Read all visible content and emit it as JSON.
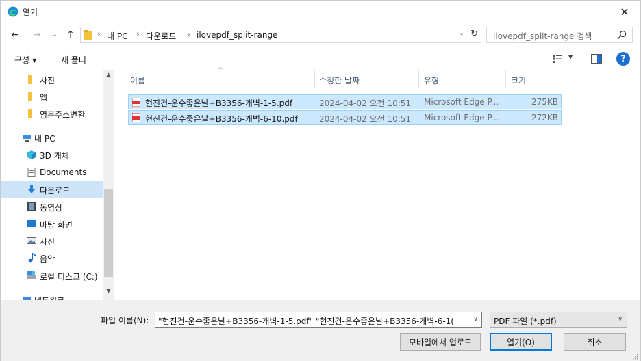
{
  "window": {
    "title": "열기",
    "close_glyph": "✕"
  },
  "nav": {
    "back_glyph": "←",
    "forward_glyph": "→",
    "recent_glyph": "⌄",
    "up_glyph": "↑",
    "breadcrumbs": [
      "내 PC",
      "다운로드",
      "ilovepdf_split-range"
    ],
    "separator": "›",
    "dropdown_glyph": "⌄",
    "refresh_glyph": "↻",
    "search_placeholder": "ilovepdf_split-range 검색"
  },
  "commands": {
    "organize": "구성",
    "organize_caret": "▼",
    "new_folder": "새 폴더",
    "view_caret": "▼",
    "help": "?"
  },
  "sidebar": {
    "items": [
      {
        "label": "사진",
        "icon": "folder-icon"
      },
      {
        "label": "앱",
        "icon": "folder-icon"
      },
      {
        "label": "영문주소변환",
        "icon": "folder-icon"
      },
      {
        "label": "내 PC",
        "icon": "pc-icon"
      },
      {
        "label": "3D 개체",
        "icon": "3d-objects-icon"
      },
      {
        "label": "Documents",
        "icon": "documents-icon"
      },
      {
        "label": "다운로드",
        "icon": "download-icon",
        "selected": true
      },
      {
        "label": "동영상",
        "icon": "video-icon"
      },
      {
        "label": "바탕 화면",
        "icon": "desktop-icon"
      },
      {
        "label": "사진",
        "icon": "pictures-icon"
      },
      {
        "label": "음악",
        "icon": "music-icon"
      },
      {
        "label": "로컬 디스크 (C:)",
        "icon": "drive-icon"
      },
      {
        "label": "네트워크",
        "icon": "network-icon"
      }
    ],
    "scroll_up_glyph": "▲",
    "scroll_down_glyph": "▼"
  },
  "filelist": {
    "columns": [
      "이름",
      "수정한 날짜",
      "유형",
      "크기"
    ],
    "sort_glyph": "^",
    "rows": [
      {
        "name": "현진건-운수좋은날+B3356-개벽-1-5.pdf",
        "modified": "2024-04-02 오전 10:51",
        "type": "Microsoft Edge P...",
        "size": "275KB",
        "selected": true
      },
      {
        "name": "현진건-운수좋은날+B3356-개벽-6-10.pdf",
        "modified": "2024-04-02 오전 10:51",
        "type": "Microsoft Edge P...",
        "size": "272KB",
        "selected": true
      }
    ]
  },
  "bottom": {
    "filename_label": "파일 이름(N):",
    "filename_value": "\"현진건-운수좋은날+B3356-개벽-1-5.pdf\" \"현진건-운수좋은날+B3356-개벽-6-1(",
    "filename_dd_glyph": "∨",
    "filetype_value": "PDF 파일 (*.pdf)",
    "filetype_dd_glyph": "∨",
    "upload_button": "모바일에서 업로드",
    "open_button": "열기(O)",
    "cancel_button": "취소"
  }
}
